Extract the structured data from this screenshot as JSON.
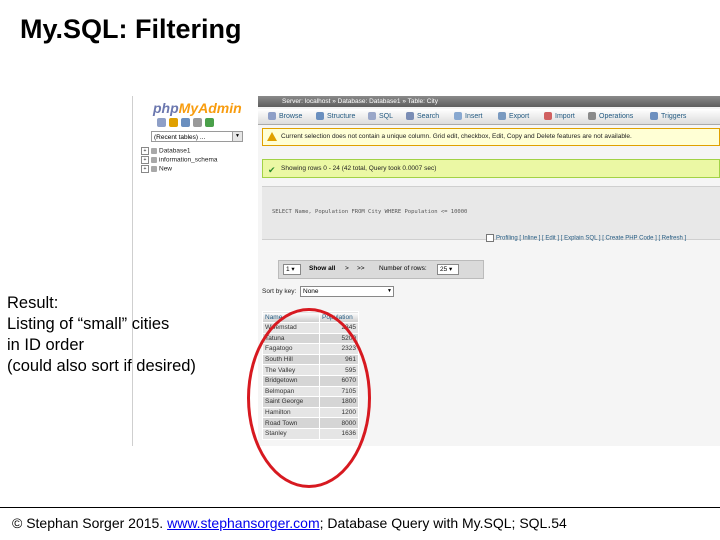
{
  "slide": {
    "title": "My.SQL: Filtering",
    "note_lines": [
      "Result:",
      "Listing of “small” cities",
      "in ID order",
      "(could also sort if desired)"
    ],
    "footer": {
      "prefix": "© Stephan Sorger 2015. ",
      "link": "www.stephansorger.com",
      "suffix": "; Database Query with My.SQL;  SQL.54"
    }
  },
  "sidebar": {
    "logo_php": "php",
    "logo_myadmin": "MyAdmin",
    "recent_tables": "(Recent tables) ...",
    "tree": [
      "Database1",
      "information_schema",
      "New"
    ]
  },
  "breadcrumb": "Server: localhost » Database: Database1 » Table: City",
  "tabs": [
    "Browse",
    "Structure",
    "SQL",
    "Search",
    "Insert",
    "Export",
    "Import",
    "Operations",
    "Triggers"
  ],
  "notice": "Current selection does not contain a unique column. Grid edit, checkbox, Edit, Copy and Delete features are not available.",
  "success": "Showing rows 0 - 24 (42 total, Query took 0.0007 sec)",
  "sql": "SELECT Name, Population FROM City WHERE Population <= 10000",
  "sql_links": {
    "profiling": "Profiling",
    "inline": "[ Inline ]",
    "edit": "[ Edit ]",
    "explain": "[ Explain SQL ]",
    "create_php": "[ Create PHP Code ]",
    "refresh": "[ Refresh ]"
  },
  "nav": {
    "page": "1",
    "show_all": "Show all",
    "next": ">",
    "last": ">>",
    "rows_label": "Number of rows:",
    "rows_value": "25"
  },
  "sort": {
    "label": "Sort by key:",
    "value": "None"
  },
  "table": {
    "headers": [
      "Name",
      "Population"
    ],
    "rows": [
      [
        "Willemstad",
        "2345"
      ],
      [
        "Tatuna",
        "5200"
      ],
      [
        "Fagatogo",
        "2323"
      ],
      [
        "South Hill",
        "961"
      ],
      [
        "The Valley",
        "595"
      ],
      [
        "Bridgetown",
        "6070"
      ],
      [
        "Belmopan",
        "7105"
      ],
      [
        "Saint George",
        "1800"
      ],
      [
        "Hamilton",
        "1200"
      ],
      [
        "Road Town",
        "8000"
      ],
      [
        "Stanley",
        "1636"
      ]
    ]
  },
  "colors": {
    "accent": "#6c78af",
    "highlight": "#d71920",
    "link": "#235a81"
  }
}
